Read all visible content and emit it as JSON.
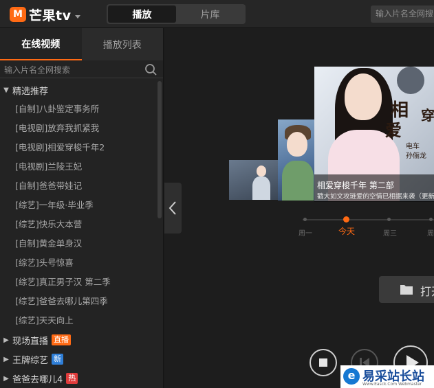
{
  "app": {
    "logo_text": "芒果tv",
    "mode_tabs": [
      {
        "label": "播放",
        "active": true
      },
      {
        "label": "片库",
        "active": false
      }
    ],
    "search_placeholder": "输入片名全网搜"
  },
  "sidebar": {
    "tabs": [
      {
        "label": "在线视频",
        "active": true
      },
      {
        "label": "播放列表",
        "active": false
      }
    ],
    "search_placeholder": "输入片名全网搜索",
    "featured_group": {
      "label": "精选推荐",
      "expanded": true,
      "items": [
        "[自制]八卦鉴定事务所",
        "[电视剧]放弃我抓紧我",
        "[电视剧]相爱穿梭千年2",
        "[电视剧]兰陵王妃",
        "[自制]爸爸带娃记",
        "[综艺]一年级·毕业季",
        "[综艺]快乐大本营",
        "[自制]黄金单身汉",
        "[综艺]头号惊喜",
        "[综艺]真正男子汉 第二季",
        "[综艺]爸爸去哪儿第四季",
        "[综艺]天天向上"
      ]
    },
    "collapsed_groups": [
      {
        "label": "现场直播",
        "badge": "直播",
        "badge_color": "#ff6a14"
      },
      {
        "label": "王牌综艺",
        "badge": "新",
        "badge_color": "#2f7fd8"
      },
      {
        "label": "爸爸去哪儿4",
        "badge": "热",
        "badge_color": "#e03b3b"
      }
    ]
  },
  "feature": {
    "title": "相爱穿梭千年 第二部",
    "description": "戳大如文攻琏爱的空情已相据来袭（更新至",
    "art_title": [
      "相",
      "爱",
      "穿"
    ],
    "art_sub": [
      "电车",
      "孙俪龙"
    ]
  },
  "timeline": {
    "days": [
      {
        "label": "周一",
        "active": false
      },
      {
        "label": "今天",
        "active": true
      },
      {
        "label": "周三",
        "active": false
      },
      {
        "label": "周",
        "active": false
      }
    ]
  },
  "player": {
    "open_label": "打开"
  },
  "watermark": {
    "text": "易采站长站",
    "url": "Www.Easck.Com  Webmaster"
  }
}
